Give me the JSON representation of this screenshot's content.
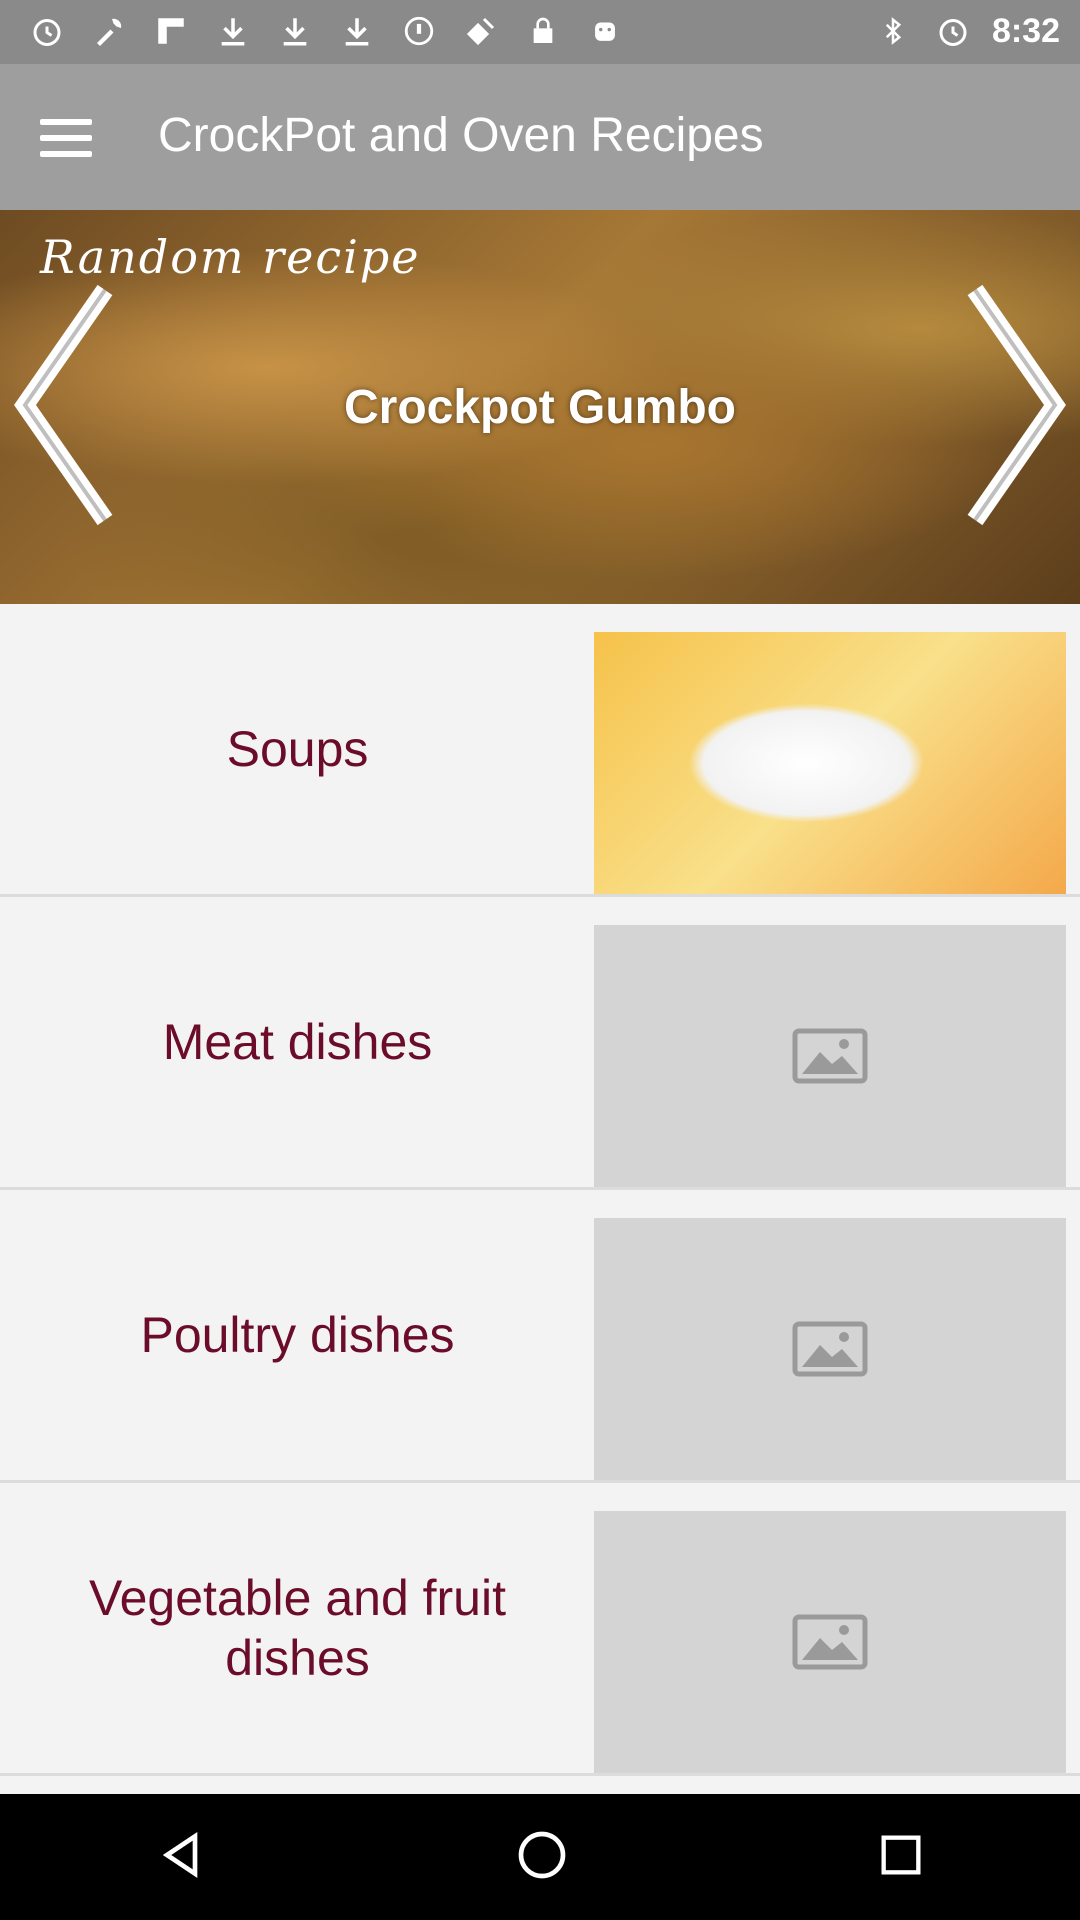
{
  "status_bar": {
    "time": "8:32",
    "left_icons": [
      "alarm-icon",
      "wrench-icon",
      "flipboard-icon",
      "download-icon",
      "download-icon",
      "download-icon",
      "info-icon",
      "satellite-icon",
      "lock-icon",
      "android-icon"
    ],
    "right_icons": [
      "bluetooth-icon",
      "alarm-icon"
    ]
  },
  "toolbar": {
    "title": "CrockPot and Oven Recipes",
    "menu_icon": "hamburger-menu-icon"
  },
  "banner": {
    "caption": "Random recipe",
    "title": "Crockpot Gumbo",
    "prev_icon": "chevron-left-icon",
    "next_icon": "chevron-right-icon"
  },
  "categories": [
    {
      "label": "Soups",
      "thumbnail": "soup-photo"
    },
    {
      "label": "Meat dishes",
      "thumbnail": "image-placeholder-icon"
    },
    {
      "label": "Poultry dishes",
      "thumbnail": "image-placeholder-icon"
    },
    {
      "label": "Vegetable and fruit dishes",
      "thumbnail": "image-placeholder-icon"
    }
  ],
  "nav_bar": {
    "buttons": [
      "back-icon",
      "home-icon",
      "recents-icon"
    ]
  }
}
